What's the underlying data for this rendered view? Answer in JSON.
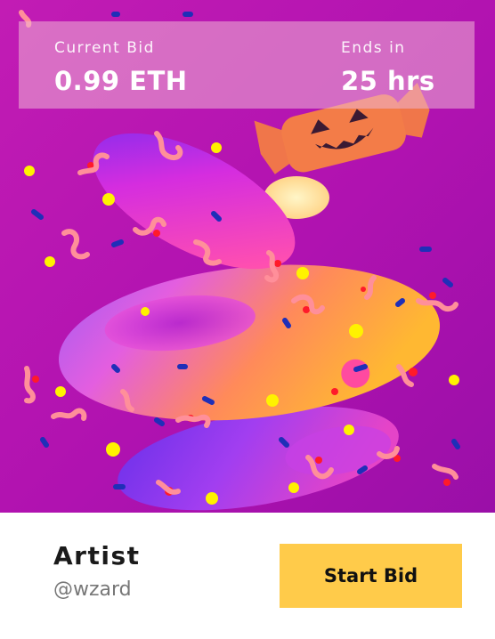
{
  "bid": {
    "current_label": "Current Bid",
    "current_value": "0.99 ETH",
    "ends_label": "Ends in",
    "ends_value": "25 hrs"
  },
  "artist": {
    "title": "Artist",
    "handle": "@wzard"
  },
  "actions": {
    "start_bid_label": "Start Bid"
  },
  "colors": {
    "background_magenta": "#b314b0",
    "button_yellow": "#ffcb4a",
    "candy_orange": "#f07845"
  },
  "artwork": {
    "subject": "halloween-candy-swirl",
    "icons": [
      "pumpkin-candy-icon",
      "gummy-worm-icon",
      "sprinkle-icon"
    ]
  }
}
